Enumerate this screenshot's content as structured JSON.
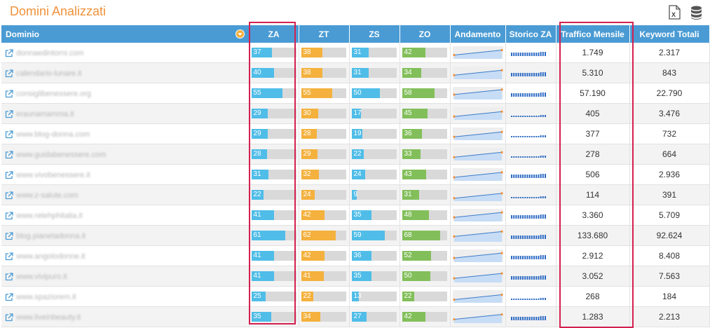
{
  "title": "Domini Analizzati",
  "headers": [
    "Dominio",
    "ZA",
    "ZT",
    "ZS",
    "ZO",
    "Andamento",
    "Storico ZA",
    "Traffico Mensile",
    "Keyword Totali"
  ],
  "colors": {
    "za": "#4fbde8",
    "zt": "#f4b13d",
    "zs": "#4fbde8",
    "zo": "#82bf5a",
    "header": "#4a9bd4",
    "title": "#f0923a",
    "highlight": "#d4204f"
  },
  "rows": [
    {
      "domain": "donnaedintorni.com",
      "za": 37,
      "zt": 38,
      "zs": 31,
      "zo": 42,
      "traffico": "1.749",
      "keyword": "2.317"
    },
    {
      "domain": "calendario-lunare.it",
      "za": 40,
      "zt": 38,
      "zs": 31,
      "zo": 34,
      "traffico": "5.310",
      "keyword": "843"
    },
    {
      "domain": "consiglibenessere.org",
      "za": 55,
      "zt": 55,
      "zs": 50,
      "zo": 58,
      "traffico": "57.190",
      "keyword": "22.790"
    },
    {
      "domain": "eraunamamma.it",
      "za": 29,
      "zt": 30,
      "zs": 17,
      "zo": 45,
      "traffico": "405",
      "keyword": "3.476"
    },
    {
      "domain": "www.blog-donna.com",
      "za": 29,
      "zt": 28,
      "zs": 19,
      "zo": 36,
      "traffico": "377",
      "keyword": "732"
    },
    {
      "domain": "www.guidabenessere.com",
      "za": 28,
      "zt": 29,
      "zs": 22,
      "zo": 33,
      "traffico": "278",
      "keyword": "664"
    },
    {
      "domain": "www.vivobenessere.it",
      "za": 31,
      "zt": 32,
      "zs": 24,
      "zo": 43,
      "traffico": "506",
      "keyword": "2.936"
    },
    {
      "domain": "www.z-salute.com",
      "za": 22,
      "zt": 24,
      "zs": 9,
      "zo": 31,
      "traffico": "114",
      "keyword": "391"
    },
    {
      "domain": "www.retehphitalia.it",
      "za": 41,
      "zt": 42,
      "zs": 35,
      "zo": 48,
      "traffico": "3.360",
      "keyword": "5.709"
    },
    {
      "domain": "blog.pianetadonna.it",
      "za": 61,
      "zt": 62,
      "zs": 59,
      "zo": 68,
      "traffico": "133.680",
      "keyword": "92.624"
    },
    {
      "domain": "www.angolodonne.it",
      "za": 41,
      "zt": 42,
      "zs": 36,
      "zo": 52,
      "traffico": "2.912",
      "keyword": "8.408"
    },
    {
      "domain": "www.vivipuro.it",
      "za": 41,
      "zt": 41,
      "zs": 35,
      "zo": 50,
      "traffico": "3.052",
      "keyword": "7.563"
    },
    {
      "domain": "www.spaziorem.it",
      "za": 25,
      "zt": 22,
      "zs": 13,
      "zo": 22,
      "traffico": "268",
      "keyword": "184"
    },
    {
      "domain": "www.liveinbeauty.it",
      "za": 35,
      "zt": 34,
      "zs": 27,
      "zo": 42,
      "traffico": "1.283",
      "keyword": "2.213"
    }
  ]
}
